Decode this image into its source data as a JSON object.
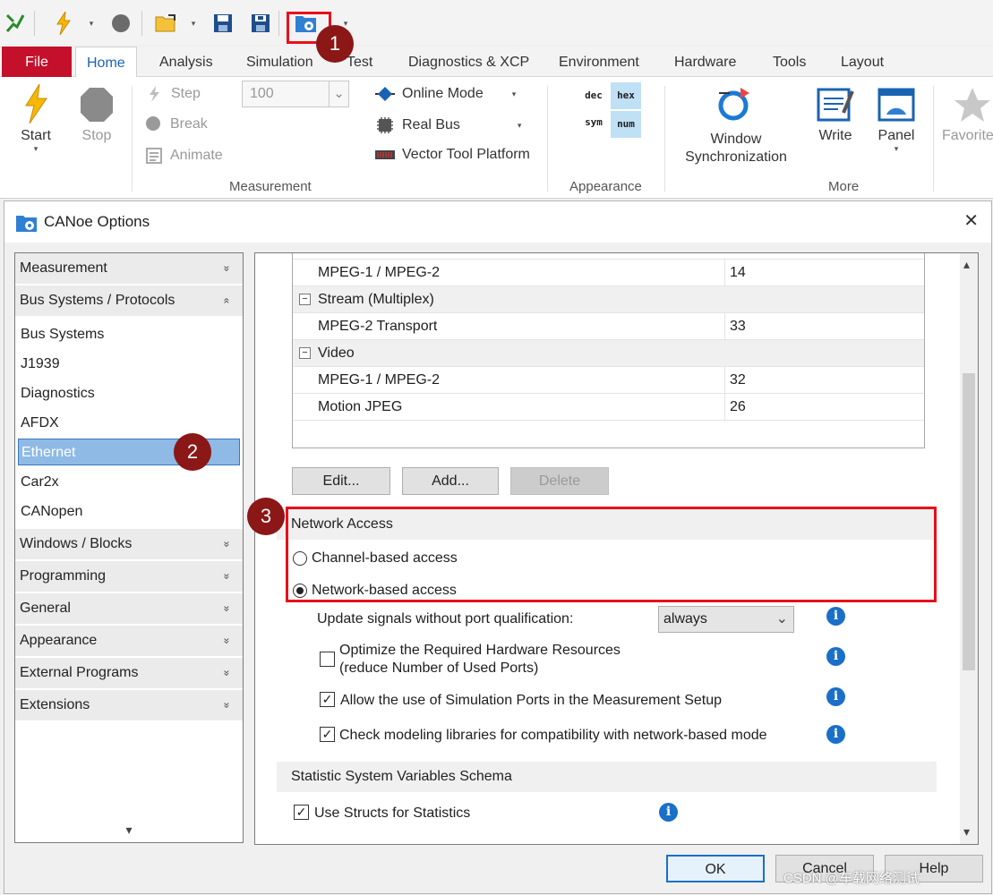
{
  "quick_access": {
    "icons": [
      "run-icon",
      "lightning-icon",
      "stop-icon",
      "open-folder-icon",
      "save-icon",
      "save-as-icon",
      "options-icon"
    ],
    "caret": "▾"
  },
  "ribbon_tabs": [
    "File",
    "Home",
    "Analysis",
    "Simulation",
    "Test",
    "Diagnostics & XCP",
    "Environment",
    "Hardware",
    "Tools",
    "Layout"
  ],
  "ribbon": {
    "measurement": {
      "start": "Start",
      "stop": "Stop",
      "step": "Step",
      "break": "Break",
      "animate": "Animate",
      "step_value": "100",
      "online_mode": "Online Mode",
      "real_bus": "Real Bus",
      "vector_tool_platform": "Vector Tool Platform",
      "group_label": "Measurement"
    },
    "appearance": {
      "dec": "dec",
      "hex": "hex",
      "sym": "sym",
      "num": "num",
      "group_label": "Appearance"
    },
    "more": {
      "window_sync_line1": "Window",
      "window_sync_line2": "Synchronization",
      "write": "Write",
      "panel": "Panel",
      "favorites": "Favorite",
      "group_label": "More"
    }
  },
  "dialog": {
    "title": "CANoe Options",
    "close": "✕",
    "nav": {
      "sections_top": [
        {
          "label": "Measurement",
          "chev": "»"
        },
        {
          "label": "Bus Systems / Protocols",
          "chev": "«"
        }
      ],
      "items": [
        "Bus Systems",
        "J1939",
        "Diagnostics",
        "AFDX",
        "Ethernet",
        "Car2x",
        "CANopen"
      ],
      "selected": "Ethernet",
      "sections_bottom": [
        {
          "label": "Windows / Blocks",
          "chev": "»"
        },
        {
          "label": "Programming",
          "chev": "»"
        },
        {
          "label": "General",
          "chev": "»"
        },
        {
          "label": "Appearance",
          "chev": "»"
        },
        {
          "label": "External Programs",
          "chev": "»"
        },
        {
          "label": "Extensions",
          "chev": "»"
        }
      ],
      "scroll_down": "▾"
    },
    "table": {
      "rows": [
        {
          "type": "item",
          "name": "MPEG-1 / MPEG-2",
          "value": "14"
        },
        {
          "type": "group",
          "name": "Stream (Multiplex)",
          "toggle": "−"
        },
        {
          "type": "item",
          "name": "MPEG-2 Transport",
          "value": "33"
        },
        {
          "type": "group",
          "name": "Video",
          "toggle": "−"
        },
        {
          "type": "item",
          "name": "MPEG-1 / MPEG-2",
          "value": "32"
        },
        {
          "type": "item",
          "name": "Motion JPEG",
          "value": "26"
        }
      ]
    },
    "buttons": {
      "edit": "Edit...",
      "add": "Add...",
      "delete": "Delete",
      "ok": "OK",
      "cancel": "Cancel",
      "help": "Help"
    },
    "network_access": {
      "heading": "Network Access",
      "channel_based": "Channel-based access",
      "network_based": "Network-based access",
      "selected": "network_based"
    },
    "options": {
      "update_signals_label": "Update signals without port qualification:",
      "update_signals_value": "always",
      "optimize_line1": "Optimize the Required Hardware Resources",
      "optimize_line2": "(reduce Number of Used Ports)",
      "optimize_checked": false,
      "allow_sim_ports": "Allow the use of Simulation Ports in the Measurement Setup",
      "allow_sim_ports_checked": true,
      "check_libraries": "Check modeling libraries for compatibility with network-based mode",
      "check_libraries_checked": true,
      "info": "i",
      "check": "✓"
    },
    "statistics": {
      "heading": "Statistic System Variables Schema",
      "use_structs": "Use Structs for Statistics",
      "use_structs_checked": true
    },
    "scroll_up": "▴",
    "scroll_down": "▾"
  },
  "annotations": {
    "badge1": "1",
    "badge2": "2",
    "badge3": "3"
  },
  "watermark": "CSDN @车载网络测试",
  "colors": {
    "file_tab": "#c4102a",
    "home_tab_text": "#1a63b3",
    "selection": "#8ebae5",
    "highlight_box": "#e8101a",
    "badge": "#8b1717",
    "info": "#1a6fc9"
  }
}
